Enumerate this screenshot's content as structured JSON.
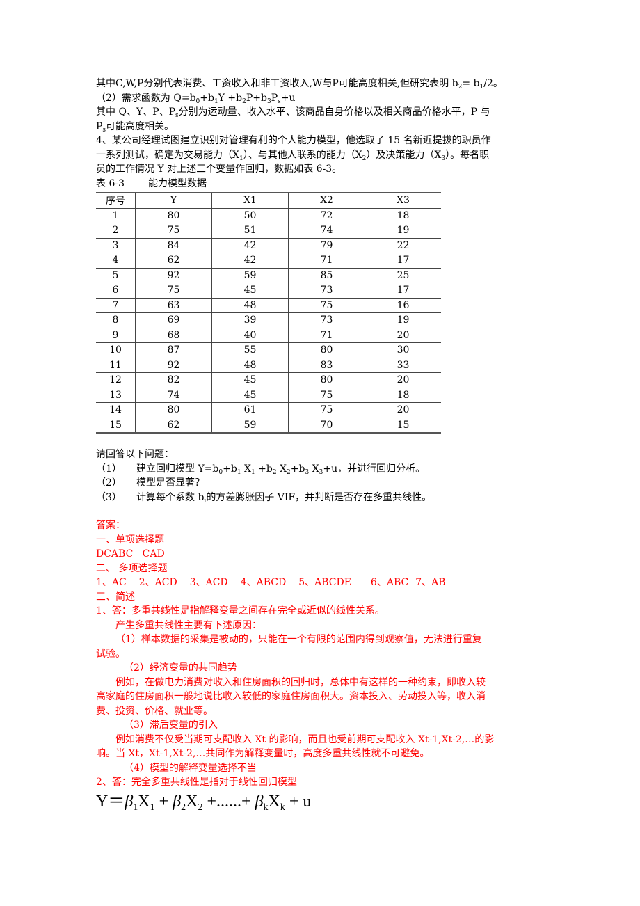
{
  "intro": {
    "line1_pre": "其中C,W,P分别代表消费、工资收入和非工资收入,W与P可能高度相关,但研究表明 b",
    "line1_sub1": "2",
    "line1_mid": "= b",
    "line1_sub2": "1",
    "line1_post": "/2。",
    "demand_label": "（2）需求函数为 Q=b",
    "demand_terms": [
      "0",
      "+b",
      "1",
      "Y +b",
      "2",
      "P+b",
      "3",
      "P",
      "s",
      "+u"
    ],
    "desc_line1_pre": "其中 Q、Y、P、P",
    "desc_line1_sub": "s",
    "desc_line1_post": "分别为运动量、收入水平、该商品自身价格以及相关商品价格水平，P 与",
    "desc_line2_pre": "P",
    "desc_line2_sub": "s",
    "desc_line2_post": "可能高度相关。"
  },
  "problem4": {
    "line1": "4、某公司经理试图建立识别对管理有利的个人能力模型，他选取了 15 名新近提拔的职员作",
    "line2_parts": [
      "一系列测试，确定为交易能力（X",
      "1",
      "）、与其他人联系的能力（X",
      "2",
      "）及决策能力（X",
      "3",
      "）。每名职"
    ],
    "line3": "员的工作情况 Y 对上述三个变量作回归，数据如表 6-3。"
  },
  "table": {
    "caption_id": "表 6-3",
    "caption_title": "能力模型数据",
    "headers": [
      "序号",
      "Y",
      "X1",
      "X2",
      "X3"
    ],
    "rows": [
      [
        "1",
        "80",
        "50",
        "72",
        "18"
      ],
      [
        "2",
        "75",
        "51",
        "74",
        "19"
      ],
      [
        "3",
        "84",
        "42",
        "79",
        "22"
      ],
      [
        "4",
        "62",
        "42",
        "71",
        "17"
      ],
      [
        "5",
        "92",
        "59",
        "85",
        "25"
      ],
      [
        "6",
        "75",
        "45",
        "73",
        "17"
      ],
      [
        "7",
        "63",
        "48",
        "75",
        "16"
      ],
      [
        "8",
        "69",
        "39",
        "73",
        "19"
      ],
      [
        "9",
        "68",
        "40",
        "71",
        "20"
      ],
      [
        "10",
        "87",
        "55",
        "80",
        "30"
      ],
      [
        "11",
        "92",
        "48",
        "83",
        "33"
      ],
      [
        "12",
        "82",
        "45",
        "80",
        "20"
      ],
      [
        "13",
        "74",
        "45",
        "75",
        "18"
      ],
      [
        "14",
        "80",
        "61",
        "75",
        "20"
      ],
      [
        "15",
        "62",
        "59",
        "70",
        "15"
      ]
    ]
  },
  "questions": {
    "heading": "请回答以下问题：",
    "items": [
      {
        "num": "（1）",
        "parts": [
          "建立回归模型 Y=b",
          "0",
          "+b",
          "1",
          " X",
          "1",
          " +b",
          "2",
          " X",
          "2",
          "+b",
          "3",
          " X",
          "3",
          "+u，并进行回归分析。"
        ]
      },
      {
        "num": "（2）",
        "text": "模型是否显著？"
      },
      {
        "num": "（3）",
        "pre": "计算每个系数 b",
        "sub": "i",
        "post": "的方差膨胀因子 VIF，并判断是否存在多重共线性。"
      }
    ]
  },
  "answers": {
    "heading": "答案：",
    "section1_title": "一、单项选择题",
    "section1_answer": "DCABC   CAD",
    "section2_title": "二、 多项选择题",
    "section2_answers": [
      "1、AC",
      "2、ACD",
      "3、ACD",
      "4、ABCD",
      "5、ABCDE",
      "6、ABC",
      "7、AB"
    ],
    "section3_title": "三、简述",
    "a1_line": "1、答：多重共线性是指解释变量之间存在完全或近似的线性关系。",
    "a1_causes": "产生多重共线性主要有下述原因：",
    "a1_c1_line1": "（1）样本数据的采集是被动的，只能在一个有限的范围内得到观察值，无法进行重复",
    "a1_c1_line2": "试验。",
    "a1_c2_title": "（2）经济变量的共同趋势",
    "a1_c2_line1": "例如，在做电力消费对收入和住房面积的回归时，总体中有这样的一种约束，即收入较",
    "a1_c2_line2": "高家庭的住房面积一般地说比收入较低的家庭住房面积大。资本投入、劳动投入等，收入消",
    "a1_c2_line3": "费、投资、价格、就业等。",
    "a1_c3_title": "（3）滞后变量的引入",
    "a1_c3_line1": "例如消费不仅受当期可支配收入 Xt 的影响，而且也受前期可支配收入 Xt-1,Xt-2,…的影",
    "a1_c3_line2": "响。当 Xt，Xt-1,Xt-2,…共同作为解释变量时，高度多重共线性就不可避免。",
    "a1_c4_title": "（4）模型的解释变量选择不当",
    "a2_line": "2、答：完全多重共线性是指对于线性回归模型",
    "formula": {
      "lhs": "Y＝",
      "terms": [
        {
          "coef": "β",
          "coef_sub": "1",
          "var": "X",
          "var_sub": "1",
          "op": " + "
        },
        {
          "coef": "β",
          "coef_sub": "2",
          "var": "X",
          "var_sub": "2",
          "op": " +......+ "
        },
        {
          "coef": "β",
          "coef_sub": "k",
          "var": "X",
          "var_sub": "k",
          "op": " + u"
        }
      ]
    }
  },
  "colors": {
    "answer_text": "#ff0000",
    "body_text": "#000000"
  }
}
